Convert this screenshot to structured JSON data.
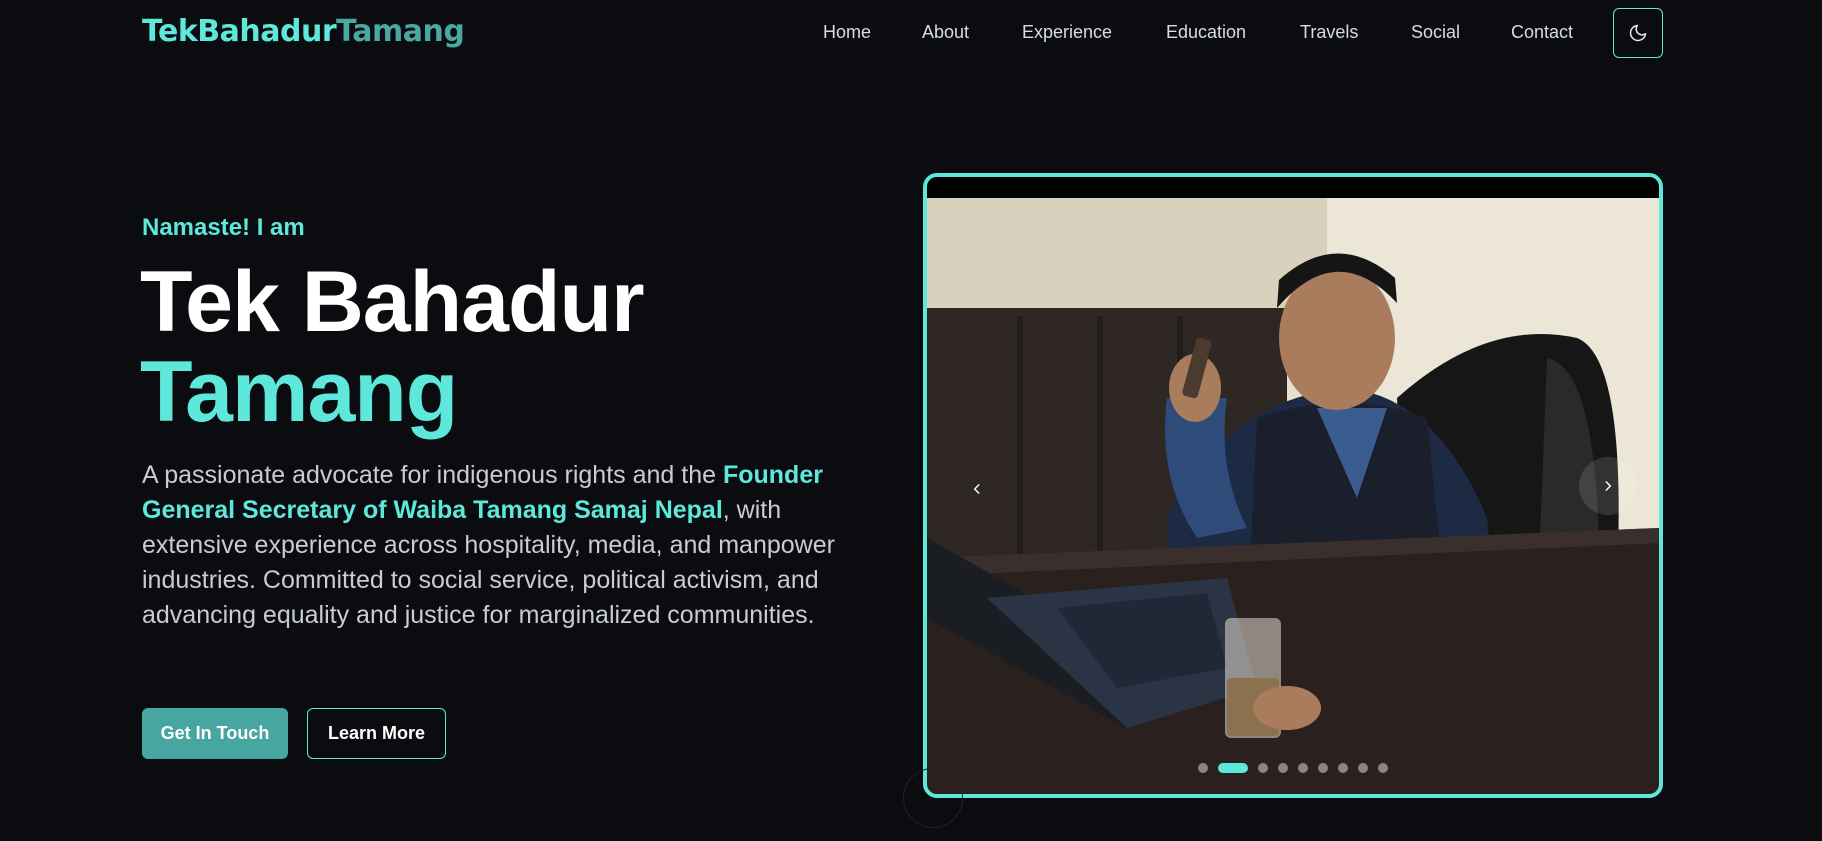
{
  "logo": {
    "first": "TekBahadur",
    "last": "Tamang"
  },
  "nav": {
    "items": [
      {
        "label": "Home"
      },
      {
        "label": "About"
      },
      {
        "label": "Experience"
      },
      {
        "label": "Education"
      },
      {
        "label": "Travels"
      },
      {
        "label": "Social"
      },
      {
        "label": "Contact"
      }
    ],
    "theme_toggle_icon": "moon-icon"
  },
  "hero": {
    "greeting": "Namaste! I am",
    "name_first": "Tek Bahadur",
    "name_last": "Tamang",
    "intro_before": "A passionate advocate for indigenous rights and the ",
    "intro_highlight": "Founder General Secretary of Waiba Tamang Samaj Nepal",
    "intro_after": ", with extensive experience across hospitality, media, and manpower industries. Committed to social service, political activism, and advancing equality and justice for marginalized communities.",
    "primary_button": "Get In Touch",
    "secondary_button": "Learn More"
  },
  "carousel": {
    "prev_icon": "chevron-left-icon",
    "next_icon": "chevron-right-icon",
    "slide_count": 10,
    "active_slide": 2
  },
  "colors": {
    "background": "#0b0c10",
    "accent": "#5ee8dc",
    "accent_dark": "#48a6a0",
    "text": "#c9ccd0"
  }
}
